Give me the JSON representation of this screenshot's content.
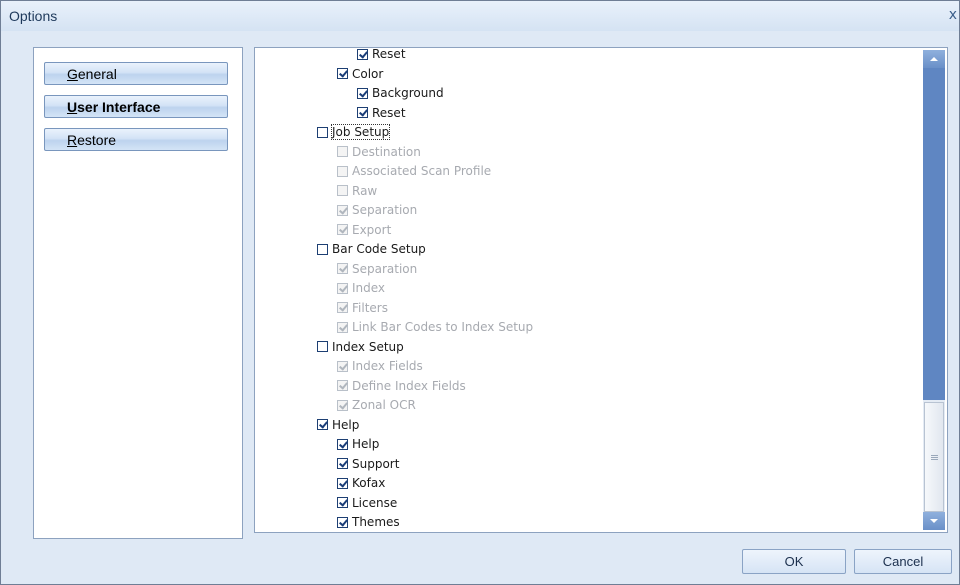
{
  "window": {
    "title": "Options",
    "close_glyph": "x"
  },
  "nav": {
    "general": {
      "mnemonic": "G",
      "rest": "eneral"
    },
    "user_interface": {
      "mnemonic": "U",
      "rest": "ser Interface"
    },
    "restore": {
      "mnemonic": "R",
      "rest": "estore"
    },
    "active": "User Interface"
  },
  "tree": {
    "items": [
      {
        "label": "Reset",
        "checked": true,
        "disabled": false,
        "indent": 2
      },
      {
        "label": "Color",
        "checked": true,
        "disabled": false,
        "indent": 1
      },
      {
        "label": "Background",
        "checked": true,
        "disabled": false,
        "indent": 2
      },
      {
        "label": "Reset",
        "checked": true,
        "disabled": false,
        "indent": 2
      },
      {
        "label": "Job Setup",
        "checked": false,
        "disabled": false,
        "indent": 0
      },
      {
        "label": "Destination",
        "checked": false,
        "disabled": true,
        "indent": 1
      },
      {
        "label": "Associated Scan Profile",
        "checked": false,
        "disabled": true,
        "indent": 1
      },
      {
        "label": "Raw",
        "checked": false,
        "disabled": true,
        "indent": 1
      },
      {
        "label": "Separation",
        "checked": true,
        "disabled": true,
        "indent": 1
      },
      {
        "label": "Export",
        "checked": true,
        "disabled": true,
        "indent": 1
      },
      {
        "label": "Bar Code Setup",
        "checked": false,
        "disabled": false,
        "indent": 0
      },
      {
        "label": "Separation",
        "checked": true,
        "disabled": true,
        "indent": 1
      },
      {
        "label": "Index",
        "checked": true,
        "disabled": true,
        "indent": 1
      },
      {
        "label": "Filters",
        "checked": true,
        "disabled": true,
        "indent": 1
      },
      {
        "label": "Link Bar Codes to Index Setup",
        "checked": true,
        "disabled": true,
        "indent": 1
      },
      {
        "label": "Index Setup",
        "checked": false,
        "disabled": false,
        "indent": 0
      },
      {
        "label": "Index Fields",
        "checked": true,
        "disabled": true,
        "indent": 1
      },
      {
        "label": "Define Index Fields",
        "checked": true,
        "disabled": true,
        "indent": 1
      },
      {
        "label": "Zonal OCR",
        "checked": true,
        "disabled": true,
        "indent": 1
      },
      {
        "label": "Help",
        "checked": true,
        "disabled": false,
        "indent": 0
      },
      {
        "label": "Help",
        "checked": true,
        "disabled": false,
        "indent": 1
      },
      {
        "label": "Support",
        "checked": true,
        "disabled": false,
        "indent": 1
      },
      {
        "label": "Kofax",
        "checked": true,
        "disabled": false,
        "indent": 1
      },
      {
        "label": "License",
        "checked": true,
        "disabled": false,
        "indent": 1
      },
      {
        "label": "Themes",
        "checked": true,
        "disabled": false,
        "indent": 1
      }
    ],
    "focused_label": "Job Setup"
  },
  "scroll": {
    "position_fraction": 0.85
  },
  "buttons": {
    "ok": "OK",
    "cancel": "Cancel"
  }
}
